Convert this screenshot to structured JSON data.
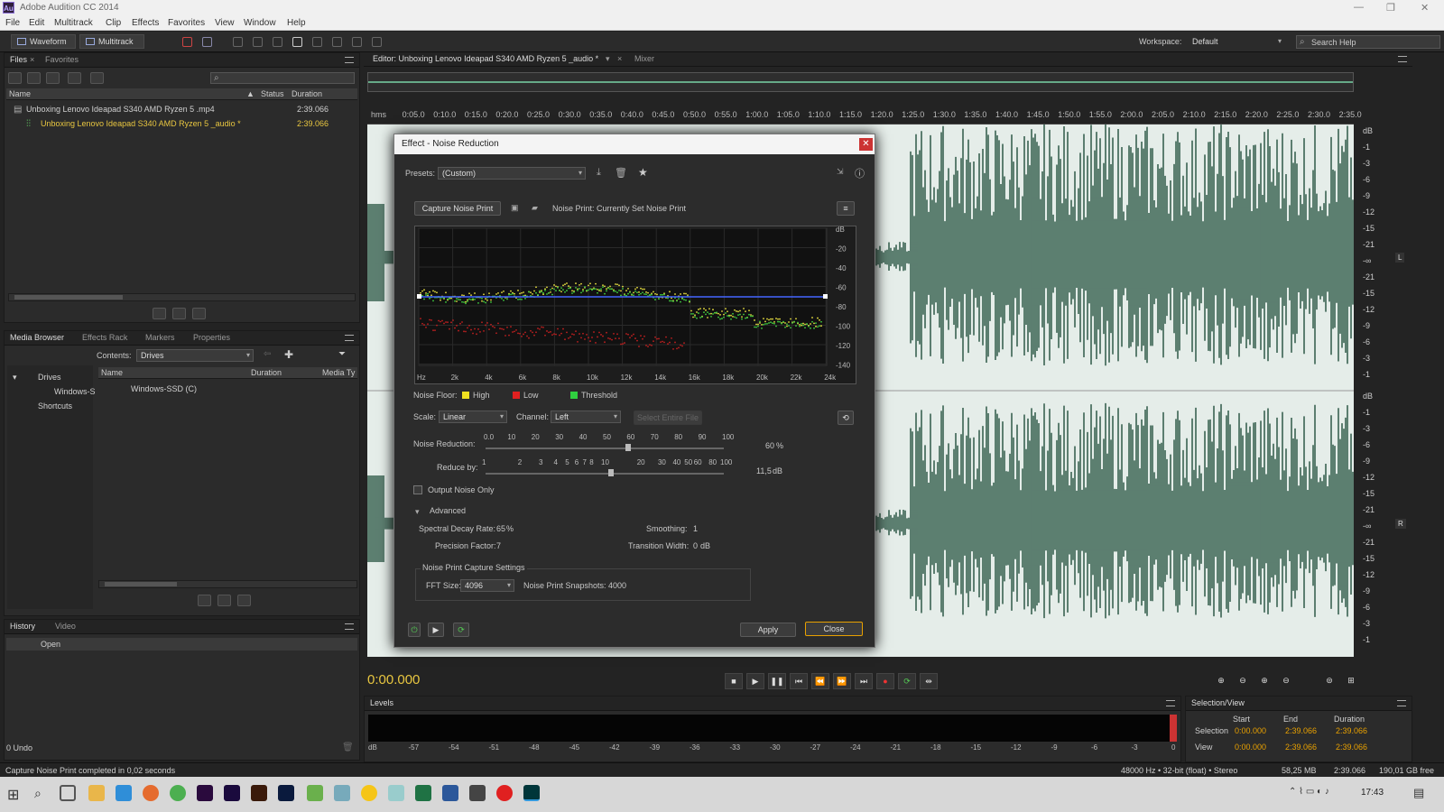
{
  "app": {
    "title": "Adobe Audition CC 2014",
    "logo": "Au"
  },
  "menu": [
    "File",
    "Edit",
    "Multitrack",
    "Clip",
    "Effects",
    "Favorites",
    "View",
    "Window",
    "Help"
  ],
  "toolbar": {
    "waveform": "Waveform",
    "multitrack": "Multitrack",
    "workspace_label": "Workspace:",
    "workspace_value": "Default",
    "search_placeholder": "Search Help"
  },
  "files_panel": {
    "tabs": [
      "Files",
      "Favorites"
    ],
    "columns": {
      "name": "Name",
      "status": "Status",
      "duration": "Duration"
    },
    "items": [
      {
        "name": "Unboxing Lenovo Ideapad S340 AMD Ryzen 5 .mp4",
        "duration": "2:39.066"
      },
      {
        "name": "Unboxing Lenovo Ideapad S340 AMD Ryzen 5 _audio *",
        "duration": "2:39.066"
      }
    ]
  },
  "media_panel": {
    "tabs": [
      "Media Browser",
      "Effects Rack",
      "Markers",
      "Properties"
    ],
    "contents_label": "Contents:",
    "contents_value": "Drives",
    "tree": [
      "Drives",
      "Windows-S",
      "Shortcuts"
    ],
    "columns": {
      "name": "Name",
      "duration": "Duration",
      "media": "Media Ty"
    },
    "items": [
      "Windows-SSD (C)"
    ]
  },
  "history_panel": {
    "tabs": [
      "History",
      "Video"
    ],
    "items": [
      "Open"
    ],
    "undo": "0 Undo"
  },
  "editor": {
    "tab": "Editor: Unboxing Lenovo Ideapad S340 AMD Ryzen 5 _audio *",
    "mixer": "Mixer",
    "ruler": [
      "hms",
      "0:05.0",
      "0:10.0",
      "0:15.0",
      "0:20.0",
      "0:25.0",
      "0:30.0",
      "0:35.0",
      "0:40.0",
      "0:45.0",
      "0:50.0",
      "0:55.0",
      "1:00.0",
      "1:05.0",
      "1:10.0",
      "1:15.0",
      "1:20.0",
      "1:25.0",
      "1:30.0",
      "1:35.0",
      "1:40.0",
      "1:45.0",
      "1:50.0",
      "1:55.0",
      "2:00.0",
      "2:05.0",
      "2:10.0",
      "2:15.0",
      "2:20.0",
      "2:25.0",
      "2:30.0",
      "2:35.0"
    ],
    "db_top": [
      "dB",
      "-1",
      "-3",
      "-6",
      "-9",
      "-12",
      "-15",
      "-21",
      "-∞",
      "-21",
      "-15",
      "-12",
      "-9",
      "-6",
      "-3",
      "-1"
    ],
    "db_bottom": [
      "dB",
      "-1",
      "-3",
      "-6",
      "-9",
      "-12",
      "-15",
      "-21",
      "-∞",
      "-21",
      "-15",
      "-12",
      "-9",
      "-6",
      "-3",
      "-1"
    ],
    "channel_l": "L",
    "channel_r": "R",
    "time": "0:00.000"
  },
  "levels": {
    "title": "Levels",
    "scale": [
      "dB",
      "-57",
      "-54",
      "-51",
      "-48",
      "-45",
      "-42",
      "-39",
      "-36",
      "-33",
      "-30",
      "-27",
      "-24",
      "-21",
      "-18",
      "-15",
      "-12",
      "-9",
      "-6",
      "-3",
      "0"
    ]
  },
  "selection_view": {
    "title": "Selection/View",
    "cols": [
      "Start",
      "End",
      "Duration"
    ],
    "rows": [
      {
        "label": "Selection",
        "start": "0:00.000",
        "end": "2:39.066",
        "duration": "2:39.066"
      },
      {
        "label": "View",
        "start": "0:00.000",
        "end": "2:39.066",
        "duration": "2:39.066"
      }
    ]
  },
  "status": {
    "message": "Capture Noise Print completed in 0,02 seconds",
    "format": "48000 Hz • 32-bit (float) • Stereo",
    "size": "58,25 MB",
    "duration": "2:39.066",
    "free": "190,01 GB free"
  },
  "clock": "17:43",
  "dialog": {
    "title": "Effect - Noise Reduction",
    "presets_label": "Presets:",
    "presets_value": "(Custom)",
    "capture_btn": "Capture Noise Print",
    "noise_print": "Noise Print: Currently Set Noise Print",
    "graph_db": [
      "dB",
      "-20",
      "-40",
      "-60",
      "-80",
      "-100",
      "-120",
      "-140"
    ],
    "graph_hz": [
      "Hz",
      "2k",
      "4k",
      "6k",
      "8k",
      "10k",
      "12k",
      "14k",
      "16k",
      "18k",
      "20k",
      "22k",
      "24k"
    ],
    "legend": {
      "label": "Noise Floor:",
      "high": "High",
      "low": "Low",
      "threshold": "Threshold"
    },
    "legend_colors": {
      "high": "#f0e020",
      "low": "#e02020",
      "threshold": "#30d040"
    },
    "scale_label": "Scale:",
    "scale_value": "Linear",
    "channel_label": "Channel:",
    "channel_value": "Left",
    "select_entire": "Select Entire File",
    "nr_label": "Noise Reduction:",
    "nr_ticks": [
      "0.0",
      "10",
      "20",
      "30",
      "40",
      "50",
      "60",
      "70",
      "80",
      "90",
      "100"
    ],
    "nr_value": "60",
    "nr_unit": "%",
    "nr_fraction": 0.6,
    "reduce_label": "Reduce by:",
    "reduce_ticks": [
      "1",
      "2",
      "3",
      "4",
      "5",
      "6",
      "7",
      "8",
      "10",
      "20",
      "30",
      "40",
      "50",
      "60",
      "80",
      "100"
    ],
    "reduce_value": "11,5",
    "reduce_unit": "dB",
    "output_noise": "Output Noise Only",
    "advanced": "Advanced",
    "spectral_label": "Spectral Decay Rate:",
    "spectral_value": "65",
    "spectral_unit": "%",
    "smoothing_label": "Smoothing:",
    "smoothing_value": "1",
    "precision_label": "Precision Factor:",
    "precision_value": "7",
    "transition_label": "Transition Width:",
    "transition_value": "0",
    "transition_unit": "dB",
    "capture_settings": "Noise Print Capture Settings",
    "fft_label": "FFT Size:",
    "fft_value": "4096",
    "snapshots_label": "Noise Print Snapshots:",
    "snapshots_value": "4000",
    "apply": "Apply",
    "close": "Close"
  }
}
